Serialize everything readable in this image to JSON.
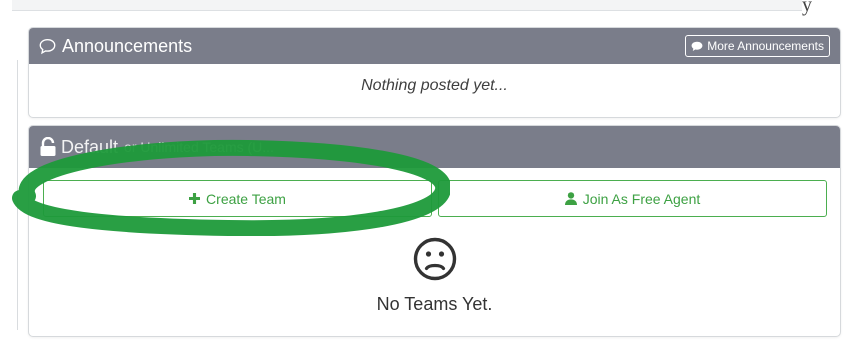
{
  "header": {
    "corner_glyph": "y"
  },
  "announcements": {
    "title": "Announcements",
    "more_button": "More Announcements",
    "empty_text": "Nothing posted yet..."
  },
  "teams": {
    "title": "Default",
    "subtitle": "or Unlimited Teams (U...",
    "create_button": "Create Team",
    "join_button": "Join As Free Agent",
    "empty_text": "No Teams Yet."
  },
  "colors": {
    "header_bg": "#7a7d8a",
    "accent_green": "#4bae4f",
    "highlight_green": "#1e9a3a"
  },
  "icons": [
    "speech-bubble-icon",
    "lock-icon",
    "plus-icon",
    "user-icon",
    "sad-face-icon"
  ]
}
